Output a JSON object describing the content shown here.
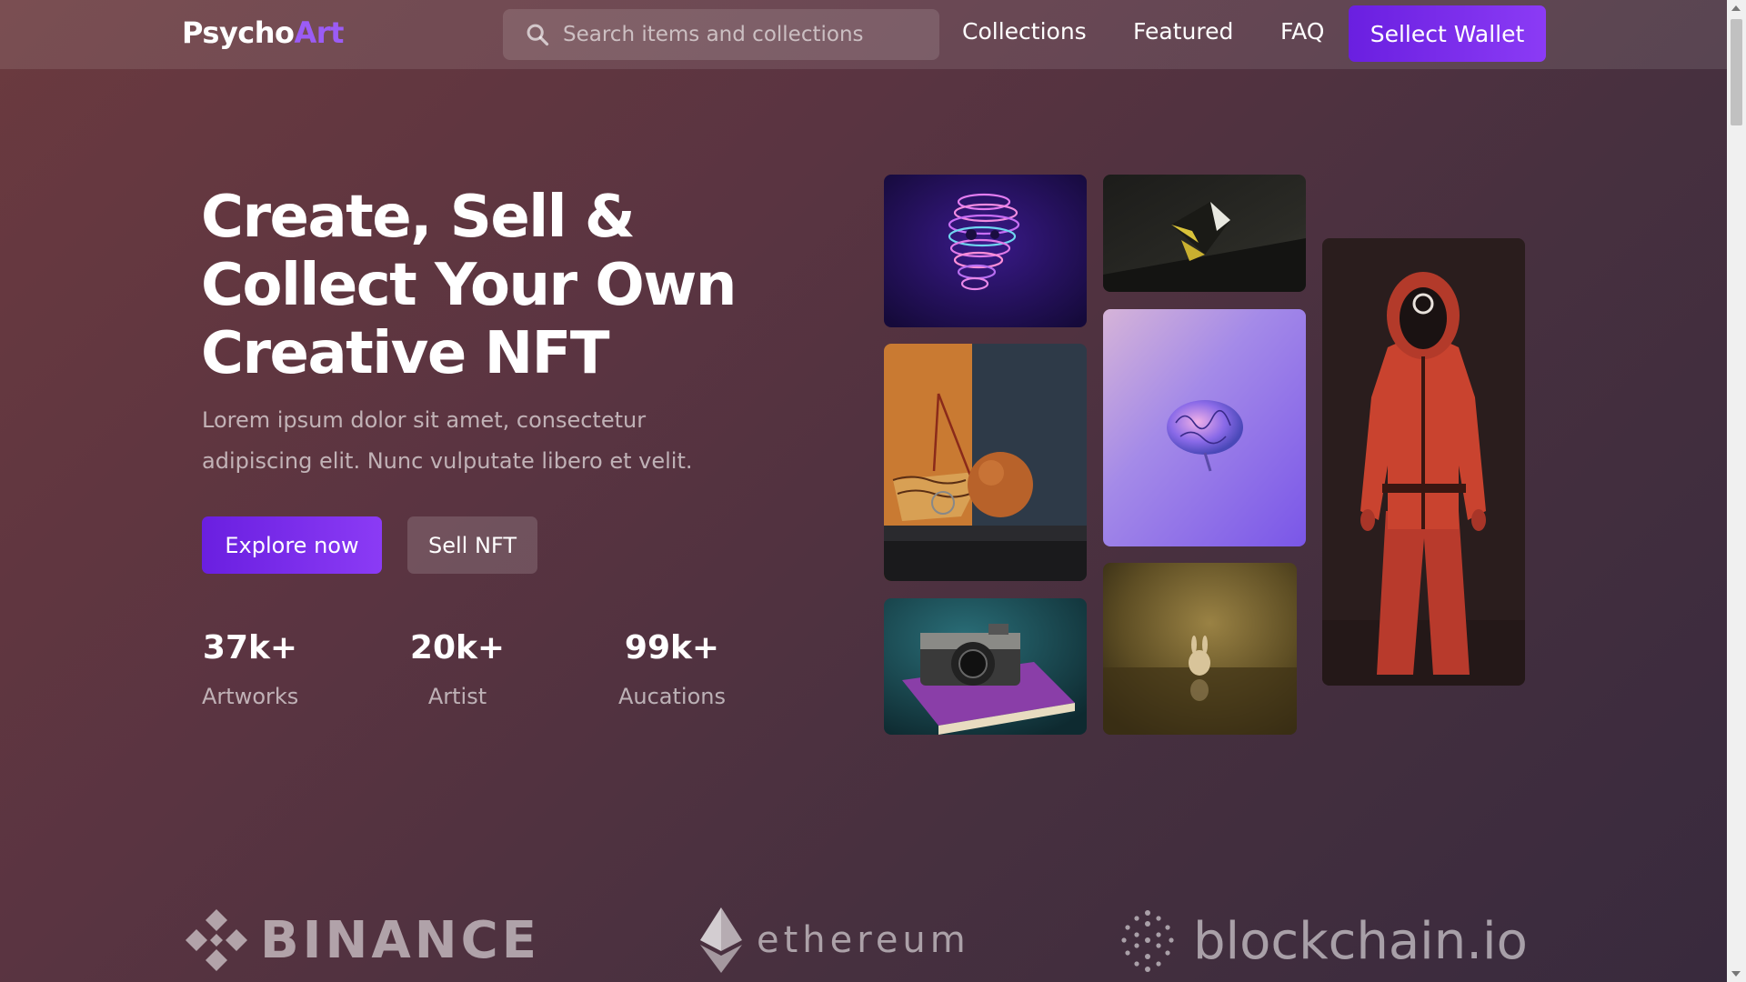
{
  "header": {
    "logo_main": "Psycho",
    "logo_accent": "Art",
    "search_placeholder": "Search items and collections",
    "nav": [
      {
        "label": "Collections"
      },
      {
        "label": "Featured"
      },
      {
        "label": "FAQ"
      }
    ],
    "wallet_label": "Sellect Wallet"
  },
  "hero": {
    "title_line1": "Create, Sell &",
    "title_line2": "Collect Your Own",
    "title_line3": "Creative NFT",
    "desc_line1": "Lorem ipsum dolor sit amet, consectetur",
    "desc_line2": "adipiscing elit. Nunc vulputate libero et velit.",
    "explore_label": "Explore now",
    "sell_label": "Sell NFT"
  },
  "stats": [
    {
      "value": "37k+",
      "label": "Artworks"
    },
    {
      "value": "20k+",
      "label": "Artist"
    },
    {
      "value": "99k+",
      "label": "Aucations"
    }
  ],
  "partners": [
    {
      "name": "BINANCE",
      "icon": "binance-logo"
    },
    {
      "name": "ethereum",
      "icon": "ethereum-logo"
    },
    {
      "name": "blockchain.io",
      "icon": "blockchain-logo"
    }
  ],
  "colors": {
    "accent": "#8b3bf5",
    "logo_accent": "#9b5cf5",
    "bg_start": "#6b3a3f",
    "bg_end": "#382a3d"
  }
}
